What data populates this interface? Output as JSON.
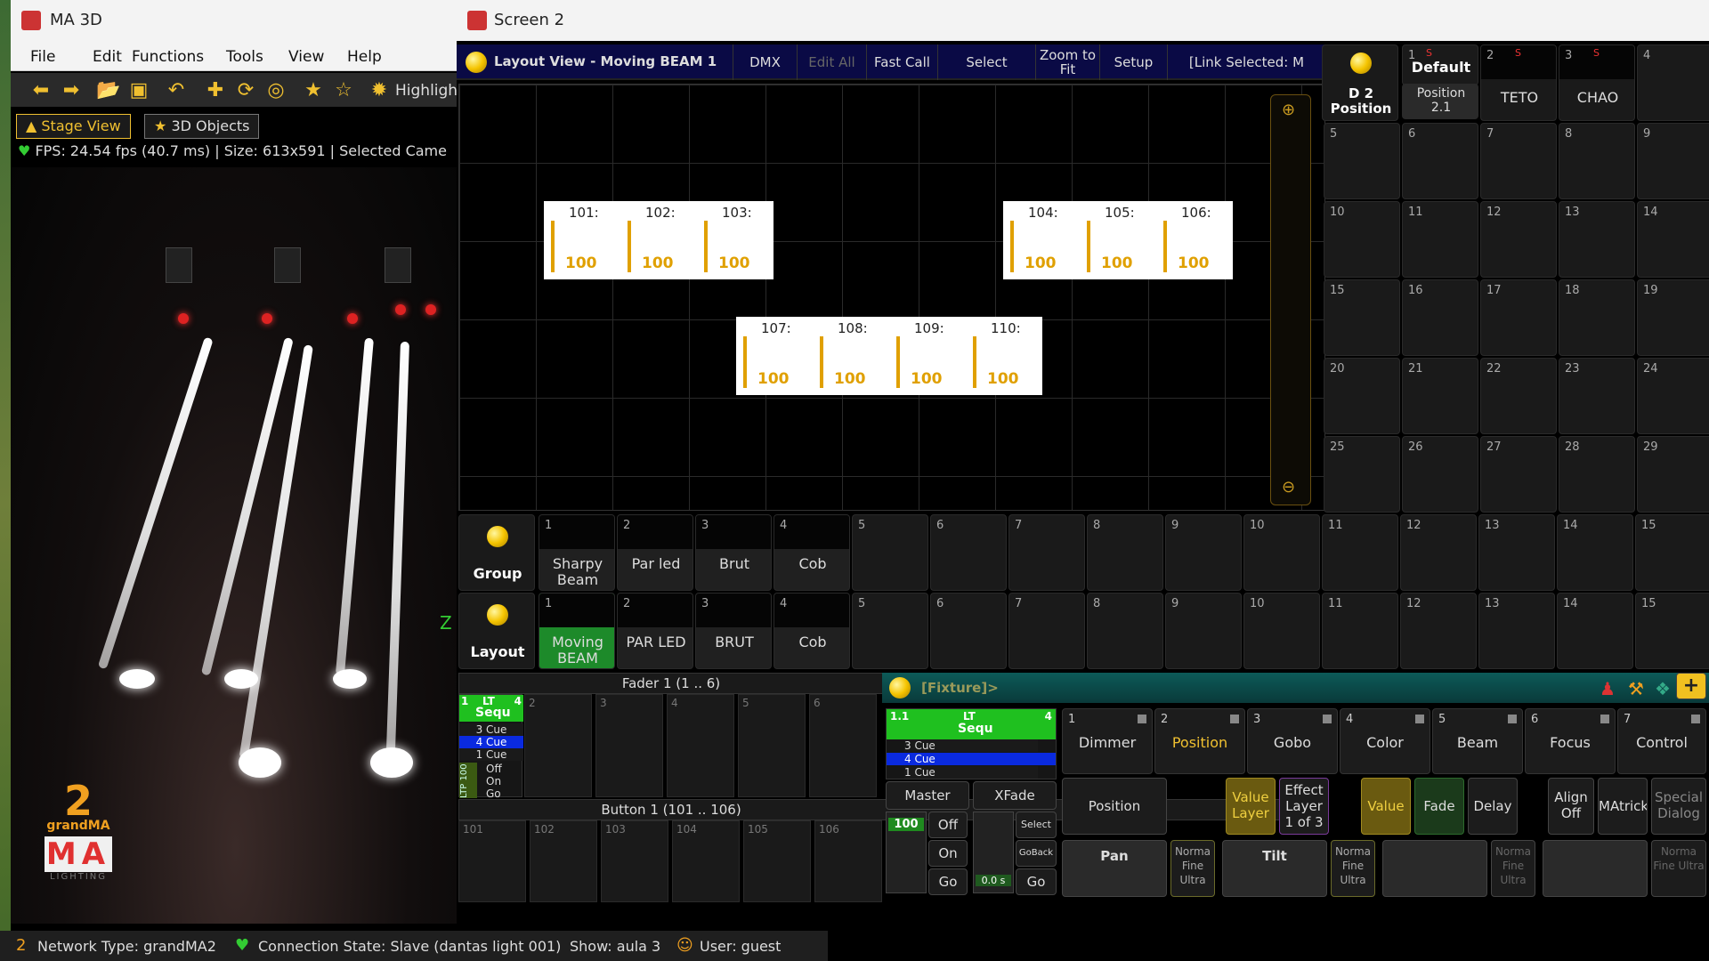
{
  "ma3d": {
    "title": "MA 3D",
    "menu": [
      "File",
      "Edit",
      "Functions",
      "Tools",
      "View",
      "Help"
    ],
    "toolbar_label": "Highligh",
    "tabs": [
      "Stage View",
      "3D Objects"
    ],
    "fps_line": "FPS: 24.54 fps (40.7 ms) | Size: 613x591 | Selected Came",
    "axis_z": "Z",
    "logo_text": "grandMA",
    "logo_num": "2",
    "logo_ma": "MA",
    "logo_sub": "LIGHTING"
  },
  "status": {
    "network": "Network Type: grandMA2",
    "connection": "Connection State: Slave (dantas light 001)",
    "show": "Show: aula 3",
    "user": "User: guest"
  },
  "screen2": {
    "title": "Screen 2",
    "bar": {
      "title": "Layout View - Moving BEAM 1",
      "dmx": "DMX",
      "edit_all": "Edit All",
      "fast_call": "Fast Call",
      "select": "Select",
      "zoom_fit_1": "Zoom to",
      "zoom_fit_2": "Fit",
      "setup": "Setup",
      "link": "[Link Selected: M"
    },
    "fixtures": [
      {
        "id": "101:",
        "val": "100"
      },
      {
        "id": "102:",
        "val": "100"
      },
      {
        "id": "103:",
        "val": "100"
      },
      {
        "id": "104:",
        "val": "100"
      },
      {
        "id": "105:",
        "val": "100"
      },
      {
        "id": "106:",
        "val": "100"
      },
      {
        "id": "107:",
        "val": "100"
      },
      {
        "id": "108:",
        "val": "100"
      },
      {
        "id": "109:",
        "val": "100"
      },
      {
        "id": "110:",
        "val": "100"
      }
    ],
    "presets": {
      "header_1": "D 2",
      "header_2": "Position",
      "items": [
        {
          "n": "1",
          "s": "S",
          "l1": "Default",
          "l2": ""
        },
        {
          "n": "2",
          "s": "S",
          "l1": "Position",
          "l2": "2.1"
        },
        {
          "n": "2",
          "s": "S",
          "l1": "TETO",
          "l2": ""
        },
        {
          "n": "3",
          "s": "S",
          "l1": "CHAO",
          "l2": ""
        }
      ],
      "numbers": [
        "4",
        "5",
        "6",
        "7",
        "8",
        "9",
        "10",
        "11",
        "12",
        "13",
        "14",
        "15",
        "16",
        "17",
        "18",
        "19",
        "20",
        "21",
        "22",
        "23",
        "24",
        "25",
        "26",
        "27",
        "28",
        "29"
      ]
    },
    "group": {
      "label": "Group",
      "items": [
        "Sharpy Beam",
        "Par led",
        "Brut",
        "Cob"
      ],
      "numbers": [
        "1",
        "2",
        "3",
        "4",
        "5",
        "6",
        "7",
        "8",
        "9",
        "10",
        "11",
        "12",
        "13",
        "14",
        "15"
      ]
    },
    "layout": {
      "label": "Layout",
      "items": [
        "Moving BEAM",
        "PAR LED",
        "BRUT",
        "Cob"
      ],
      "numbers": [
        "1",
        "2",
        "3",
        "4",
        "5",
        "6",
        "7",
        "8",
        "9",
        "10",
        "11",
        "12",
        "13",
        "14",
        "15"
      ]
    },
    "fader_title": "Fader  1 (1 .. 6)",
    "button_title": "Button  1 (101 .. 106)",
    "exec1": {
      "num": "1",
      "lt": "LT",
      "four": "4",
      "name": "Sequ",
      "cue3": "3 Cue",
      "cue4": "4 Cue",
      "cue1": "1 Cue",
      "off": "Off",
      "on": "On",
      "go": "Go",
      "ltp": "LTP 100"
    },
    "fader_nums": [
      "2",
      "3",
      "4",
      "5",
      "6"
    ],
    "button_nums": [
      "101",
      "102",
      "103",
      "104",
      "105",
      "106"
    ],
    "fixture_bar": {
      "label": "[Fixture]>"
    },
    "main_exec": {
      "num": "1.1",
      "lt": "LT",
      "four": "4",
      "name": "Sequ",
      "cue3": "3 Cue",
      "cue4": "4 Cue",
      "cue1": "1 Cue",
      "master": "Master",
      "xfade": "XFade",
      "val": "100",
      "off": "Off",
      "on": "On",
      "go": "Go",
      "select": "Select",
      "goback": "GoBack",
      "go2": "Go",
      "xfade_val": "0.0 s"
    },
    "features": [
      {
        "n": "1",
        "l": "Dimmer"
      },
      {
        "n": "2",
        "l": "Position"
      },
      {
        "n": "3",
        "l": "Gobo"
      },
      {
        "n": "4",
        "l": "Color"
      },
      {
        "n": "5",
        "l": "Beam"
      },
      {
        "n": "6",
        "l": "Focus"
      },
      {
        "n": "7",
        "l": "Control"
      }
    ],
    "attr": {
      "position": "Position",
      "value_layer": "Value Layer",
      "effect_layer": "Effect Layer 1 of 3",
      "value": "Value",
      "fade": "Fade",
      "delay": "Delay",
      "align_off": "Align Off",
      "matricks": "MAtrick",
      "special": "Special Dialog",
      "pan": "Pan",
      "tilt": "Tilt",
      "norm": "Norma Fine Ultra"
    }
  }
}
